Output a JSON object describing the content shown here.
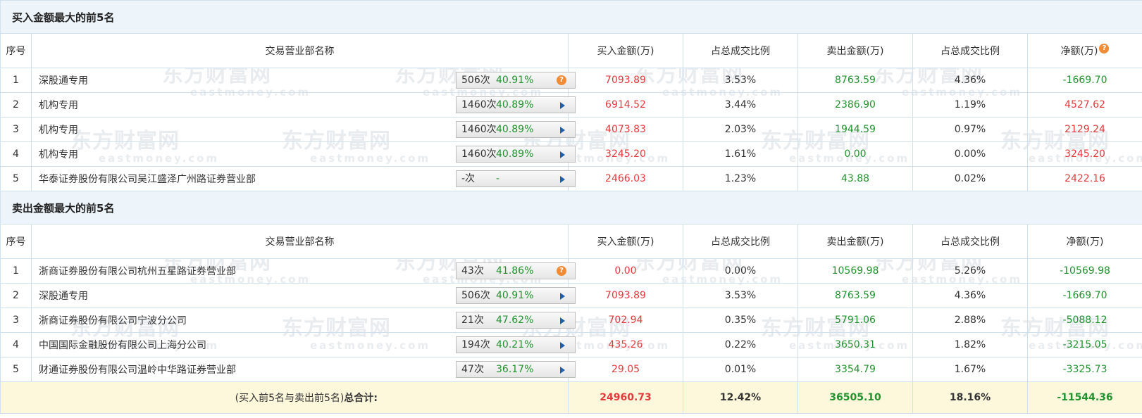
{
  "watermark": {
    "brand": "东方财富网",
    "domain": "eastmoney.com"
  },
  "buy_section": {
    "title": "买入金额最大的前5名",
    "headers": [
      "序号",
      "交易营业部名称",
      "买入金额(万)",
      "占总成交比例",
      "卖出金额(万)",
      "占总成交比例",
      "净额(万)"
    ],
    "rows": [
      {
        "idx": "1",
        "name": "深股通专用",
        "times": "506次",
        "pct": "40.91%",
        "icon": "question-icon",
        "buy": "7093.89",
        "buy_ratio": "3.53%",
        "sell": "8763.59",
        "sell_ratio": "4.36%",
        "net": "-1669.70",
        "net_color": "green"
      },
      {
        "idx": "2",
        "name": "机构专用",
        "times": "1460次",
        "pct": "40.89%",
        "icon": "arrow-right-icon",
        "buy": "6914.52",
        "buy_ratio": "3.44%",
        "sell": "2386.90",
        "sell_ratio": "1.19%",
        "net": "4527.62",
        "net_color": "red"
      },
      {
        "idx": "3",
        "name": "机构专用",
        "times": "1460次",
        "pct": "40.89%",
        "icon": "arrow-right-icon",
        "buy": "4073.83",
        "buy_ratio": "2.03%",
        "sell": "1944.59",
        "sell_ratio": "0.97%",
        "net": "2129.24",
        "net_color": "red"
      },
      {
        "idx": "4",
        "name": "机构专用",
        "times": "1460次",
        "pct": "40.89%",
        "icon": "arrow-right-icon",
        "buy": "3245.20",
        "buy_ratio": "1.61%",
        "sell": "0.00",
        "sell_ratio": "0.00%",
        "net": "3245.20",
        "net_color": "red"
      },
      {
        "idx": "5",
        "name": "华泰证券股份有限公司吴江盛泽广州路证券营业部",
        "times": "-次",
        "pct": "-",
        "icon": "arrow-right-icon",
        "buy": "2466.03",
        "buy_ratio": "1.23%",
        "sell": "43.88",
        "sell_ratio": "0.02%",
        "net": "2422.16",
        "net_color": "red"
      }
    ]
  },
  "sell_section": {
    "title": "卖出金额最大的前5名",
    "headers": [
      "序号",
      "交易营业部名称",
      "买入金额(万)",
      "占总成交比例",
      "卖出金额(万)",
      "占总成交比例",
      "净额(万)"
    ],
    "rows": [
      {
        "idx": "1",
        "name": "浙商证券股份有限公司杭州五星路证券营业部",
        "times": "43次",
        "pct": "41.86%",
        "icon": "question-icon",
        "buy": "0.00",
        "buy_ratio": "0.00%",
        "sell": "10569.98",
        "sell_ratio": "5.26%",
        "net": "-10569.98",
        "net_color": "green"
      },
      {
        "idx": "2",
        "name": "深股通专用",
        "times": "506次",
        "pct": "40.91%",
        "icon": "arrow-right-icon",
        "buy": "7093.89",
        "buy_ratio": "3.53%",
        "sell": "8763.59",
        "sell_ratio": "4.36%",
        "net": "-1669.70",
        "net_color": "green"
      },
      {
        "idx": "3",
        "name": "浙商证券股份有限公司宁波分公司",
        "times": "21次",
        "pct": "47.62%",
        "icon": "arrow-right-icon",
        "buy": "702.94",
        "buy_ratio": "0.35%",
        "sell": "5791.06",
        "sell_ratio": "2.88%",
        "net": "-5088.12",
        "net_color": "green"
      },
      {
        "idx": "4",
        "name": "中国国际金融股份有限公司上海分公司",
        "times": "194次",
        "pct": "40.21%",
        "icon": "arrow-right-icon",
        "buy": "435.26",
        "buy_ratio": "0.22%",
        "sell": "3650.31",
        "sell_ratio": "1.82%",
        "net": "-3215.05",
        "net_color": "green"
      },
      {
        "idx": "5",
        "name": "财通证券股份有限公司温岭中华路证券营业部",
        "times": "47次",
        "pct": "36.17%",
        "icon": "arrow-right-icon",
        "buy": "29.05",
        "buy_ratio": "0.01%",
        "sell": "3354.79",
        "sell_ratio": "1.67%",
        "net": "-3325.73",
        "net_color": "green"
      }
    ]
  },
  "total": {
    "label_prefix": "(买入前5名与卖出前5名)",
    "label_bold": "总合计:",
    "buy": "24960.73",
    "buy_ratio": "12.42%",
    "sell": "36505.10",
    "sell_ratio": "18.16%",
    "net": "-11544.36"
  },
  "colors": {
    "red": "#e4393c",
    "green": "#22922f",
    "header_bg": "#edf5fb",
    "total_bg": "#fdf7dc",
    "arrow": "#1f5fa8",
    "question": "#f08b36"
  }
}
